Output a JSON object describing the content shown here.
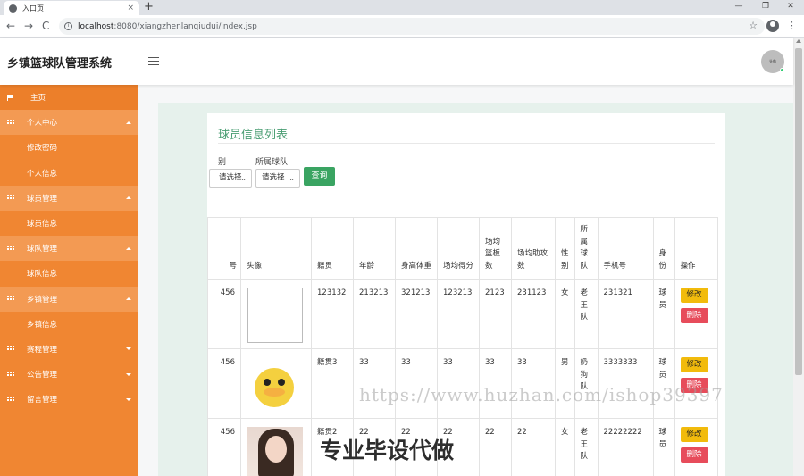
{
  "browser": {
    "tab_title": "入口页",
    "tab_close": "×",
    "new_tab": "+",
    "url_host": "localhost",
    "url_rest": ":8080/xiangzhenlanqiudui/index.jsp",
    "win_min": "—",
    "win_max": "❐",
    "win_close": "✕",
    "back": "←",
    "forward": "→",
    "reload": "C",
    "star": "☆",
    "menu": "⋮"
  },
  "header": {
    "title": "乡镇篮球队管理系统",
    "avatar_text": "头像"
  },
  "sidebar": {
    "items": [
      {
        "label": "主页",
        "type": "top",
        "icon": "flag-icon"
      },
      {
        "label": "个人中心",
        "type": "group",
        "icon": "grid-icon",
        "caret": "up"
      },
      {
        "label": "修改密码",
        "type": "sub"
      },
      {
        "label": "个人信息",
        "type": "sub"
      },
      {
        "label": "球员管理",
        "type": "group",
        "icon": "grid-icon",
        "caret": "up"
      },
      {
        "label": "球员信息",
        "type": "sub"
      },
      {
        "label": "球队管理",
        "type": "group",
        "icon": "grid-icon",
        "caret": "up"
      },
      {
        "label": "球队信息",
        "type": "sub"
      },
      {
        "label": "乡镇管理",
        "type": "group",
        "icon": "grid-icon",
        "caret": "up"
      },
      {
        "label": "乡镇信息",
        "type": "sub"
      },
      {
        "label": "赛程管理",
        "type": "top-group",
        "icon": "grid-icon",
        "caret": "down"
      },
      {
        "label": "公告管理",
        "type": "top-group",
        "icon": "grid-icon",
        "caret": "down"
      },
      {
        "label": "留言管理",
        "type": "top-group",
        "icon": "grid-icon",
        "caret": "down"
      }
    ]
  },
  "card": {
    "title": "球员信息列表",
    "filter1_label": "别",
    "filter2_label": "所属球队",
    "filter1_value": "请选择",
    "filter2_value": "请选择",
    "query_button": "查询"
  },
  "table": {
    "headers": [
      "号",
      "头像",
      "籍贯",
      "年龄",
      "身高体重",
      "场均得分",
      "场均篮板数",
      "场均助攻数",
      "性别",
      "所属球队",
      "手机号",
      "身份",
      "操作"
    ],
    "rows": [
      {
        "id": "456",
        "image": "broken",
        "origin": "123132",
        "age": "213213",
        "hw": "321213",
        "pts": "123213",
        "reb": "2123",
        "ast": "231123",
        "gender": "女",
        "team": "老王队",
        "phone": "231321",
        "role": "球员"
      },
      {
        "id": "456",
        "image": "duck",
        "origin": "籍贯3",
        "age": "33",
        "hw": "33",
        "pts": "33",
        "reb": "33",
        "ast": "33",
        "gender": "男",
        "team": "奶狗队",
        "phone": "3333333",
        "role": "球员"
      },
      {
        "id": "456",
        "image": "portrait",
        "origin": "籍贯2",
        "age": "22",
        "hw": "22",
        "pts": "22",
        "reb": "22",
        "ast": "22",
        "gender": "女",
        "team": "老王队",
        "phone": "22222222",
        "role": "球员"
      }
    ],
    "edit_label": "修改",
    "delete_label": "删除"
  },
  "watermark": {
    "url": "https://www.huzhan.com/ishop39397",
    "text": "专业毕设代做"
  },
  "colors": {
    "sidebar": "#f08632",
    "title_green": "#4a9e73",
    "query_green": "#3aa462",
    "edit_yellow": "#f2bb0c",
    "delete_red": "#e74c5b"
  }
}
